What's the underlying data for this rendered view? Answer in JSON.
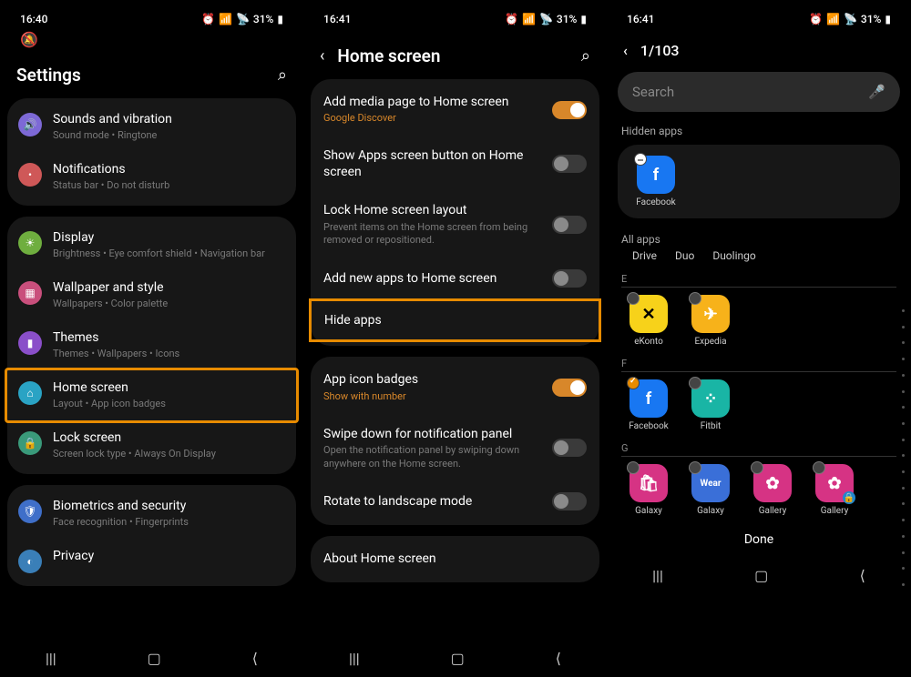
{
  "statusbar": {
    "time1": "16:40",
    "time2": "16:41",
    "time3": "16:41",
    "battery": "31%",
    "mute_icon": "🔕",
    "alarm_icon": "⏰",
    "wifi_icon": "📶"
  },
  "phone1": {
    "title": "Settings",
    "groups": [
      {
        "card": [
          {
            "icon": "🔊",
            "bg": "#7d69d6",
            "title": "Sounds and vibration",
            "sub": "Sound mode  •  Ringtone"
          },
          {
            "icon": "•",
            "bg": "#cf5858",
            "title": "Notifications",
            "sub": "Status bar  •  Do not disturb"
          }
        ]
      },
      {
        "card": [
          {
            "icon": "☀",
            "bg": "#6fae3f",
            "title": "Display",
            "sub": "Brightness  •  Eye comfort shield  •  Navigation bar"
          },
          {
            "icon": "▦",
            "bg": "#c94f7c",
            "title": "Wallpaper and style",
            "sub": "Wallpapers  •  Color palette"
          },
          {
            "icon": "▮",
            "bg": "#8a4fc9",
            "title": "Themes",
            "sub": "Themes  •  Wallpapers  •  Icons"
          },
          {
            "icon": "⌂",
            "bg": "#2aa3c4",
            "title": "Home screen",
            "sub": "Layout  •  App icon badges",
            "highlighted": true
          },
          {
            "icon": "🔒",
            "bg": "#3a9a7a",
            "title": "Lock screen",
            "sub": "Screen lock type  •  Always On Display"
          }
        ]
      },
      {
        "card": [
          {
            "icon": "🛡",
            "bg": "#3f6fc9",
            "title": "Biometrics and security",
            "sub": "Face recognition  •  Fingerprints"
          },
          {
            "icon": "◐",
            "bg": "#3a7fb8",
            "title": "Privacy",
            "sub": ""
          }
        ]
      }
    ]
  },
  "phone2": {
    "title": "Home screen",
    "groups": [
      {
        "card": [
          {
            "title": "Add media page to Home screen",
            "sub": "Google Discover",
            "sub_orange": true,
            "toggle": "on"
          },
          {
            "title": "Show Apps screen button on Home screen",
            "toggle": "off"
          },
          {
            "title": "Lock Home screen layout",
            "sub": "Prevent items on the Home screen from being removed or repositioned.",
            "toggle": "off"
          },
          {
            "title": "Add new apps to Home screen",
            "toggle": "off"
          },
          {
            "title": "Hide apps",
            "highlighted": true
          }
        ]
      },
      {
        "card": [
          {
            "title": "App icon badges",
            "sub": "Show with number",
            "sub_orange": true,
            "toggle": "on"
          },
          {
            "title": "Swipe down for notification panel",
            "sub": "Open the notification panel by swiping down anywhere on the Home screen.",
            "toggle": "off"
          },
          {
            "title": "Rotate to landscape mode",
            "toggle": "off"
          }
        ]
      },
      {
        "card": [
          {
            "title": "About Home screen"
          }
        ]
      }
    ]
  },
  "phone3": {
    "counter": "1/103",
    "search_placeholder": "Search",
    "hidden_label": "Hidden apps",
    "hidden_app": {
      "name": "Facebook",
      "bg": "#1877f2",
      "letter": "f"
    },
    "all_label": "All apps",
    "d_items": [
      "Drive",
      "Duo",
      "Duolingo"
    ],
    "sections": [
      {
        "letter": "E",
        "apps": [
          {
            "name": "eKonto",
            "bg": "#f7d21a",
            "fg": "#000",
            "letter": "✕"
          },
          {
            "name": "Expedia",
            "bg": "#f7b21a",
            "fg": "#fff",
            "letter": "✈"
          }
        ]
      },
      {
        "letter": "F",
        "apps": [
          {
            "name": "Facebook",
            "bg": "#1877f2",
            "fg": "#fff",
            "letter": "f",
            "checked": true
          },
          {
            "name": "Fitbit",
            "bg": "#19b5a5",
            "fg": "#fff",
            "letter": "⁘"
          }
        ]
      },
      {
        "letter": "G",
        "apps": [
          {
            "name": "Galaxy",
            "bg": "#d63384",
            "fg": "#fff",
            "letter": "🛍"
          },
          {
            "name": "Galaxy",
            "bg": "#3a6fd8",
            "fg": "#fff",
            "letter": "Wear",
            "small": true
          },
          {
            "name": "Gallery",
            "bg": "#d63384",
            "fg": "#fff",
            "letter": "✿"
          },
          {
            "name": "Gallery",
            "bg": "#d63384",
            "fg": "#fff",
            "letter": "✿",
            "lock": true
          }
        ]
      }
    ],
    "done": "Done"
  },
  "nav": {
    "recent": "|||",
    "home": "◯",
    "back": "⟨"
  }
}
